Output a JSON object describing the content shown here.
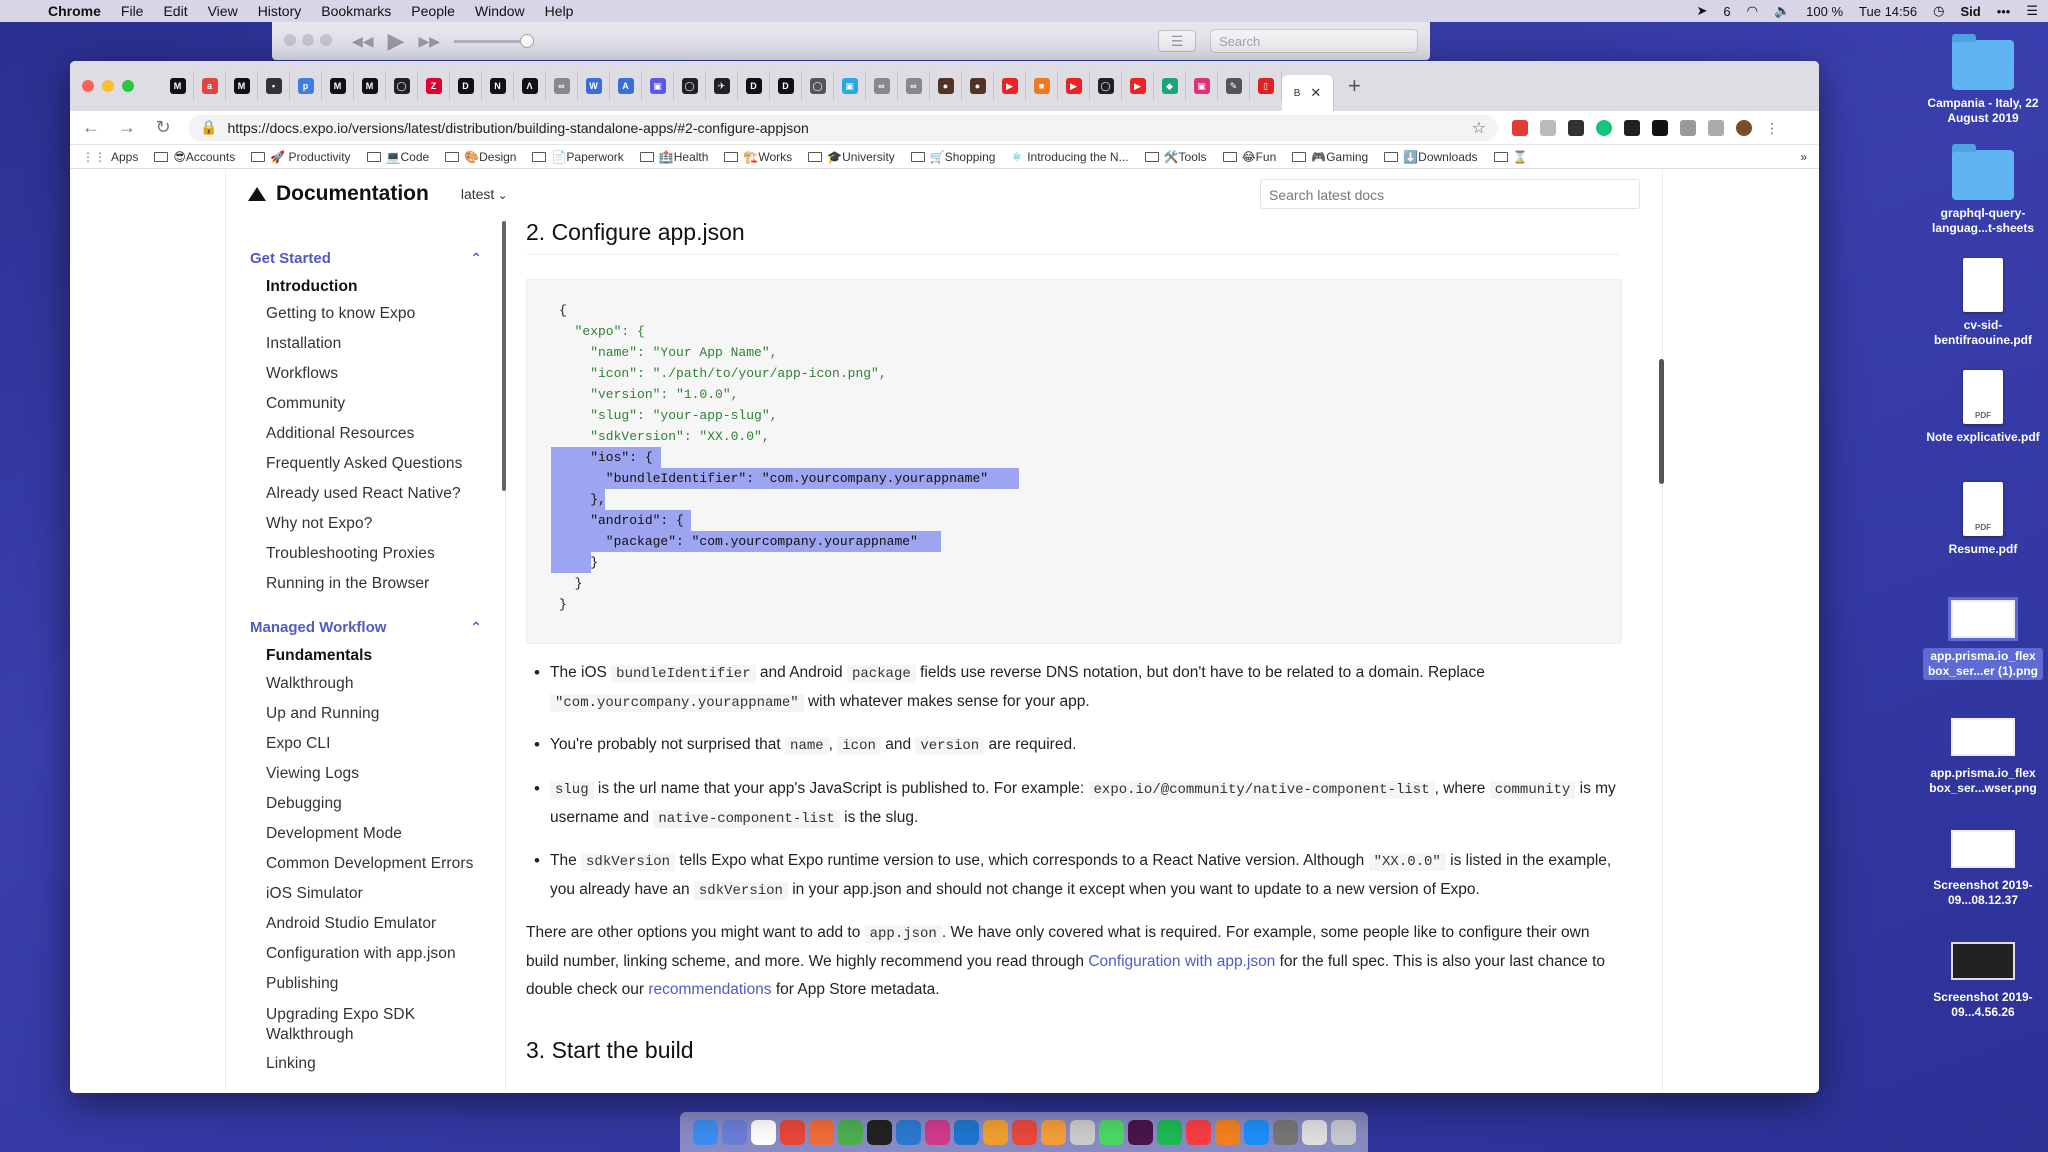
{
  "menubar": {
    "app": "Chrome",
    "items": [
      "File",
      "Edit",
      "View",
      "History",
      "Bookmarks",
      "People",
      "Window",
      "Help"
    ],
    "right": {
      "notif_count": "6",
      "battery": "100 %",
      "clock": "Tue 14:56",
      "user": "Sid"
    }
  },
  "player": {
    "search_placeholder": "Search"
  },
  "desktop": {
    "icons": [
      {
        "label": "Campania - Italy, 22 August 2019",
        "kind": "folder"
      },
      {
        "label": "graphql-query-languag...t-sheets",
        "kind": "folder"
      },
      {
        "label": "cv-sid-bentifraouine.pdf",
        "kind": "doc",
        "badge": ""
      },
      {
        "label": "Note explicative.pdf",
        "kind": "doc",
        "badge": "PDF"
      },
      {
        "label": "Resume.pdf",
        "kind": "doc",
        "badge": "PDF"
      },
      {
        "label": "app.prisma.io_flex box_ser...er (1).png",
        "kind": "shot",
        "selected": true
      },
      {
        "label": "app.prisma.io_flex box_ser...wser.png",
        "kind": "shot"
      },
      {
        "label": "Screenshot 2019-09...08.12.37",
        "kind": "shot"
      },
      {
        "label": "Screenshot 2019-09...4.56.26",
        "kind": "shot-dark"
      }
    ]
  },
  "browser": {
    "active_tab_label": "B",
    "url": "https://docs.expo.io/versions/latest/distribution/building-standalone-apps/#2-configure-appjson",
    "bookmarks": [
      "Apps",
      "😎Accounts",
      "🚀 Productivity",
      "💻Code",
      "🎨Design",
      "📄Paperwork",
      "🏥Health",
      "🏗️Works",
      "🎓University",
      "🛒Shopping",
      "Introducing the N...",
      "🛠️Tools",
      "😂Fun",
      "🎮Gaming",
      "⬇️Downloads",
      "⌛"
    ]
  },
  "docs": {
    "title": "Documentation",
    "version": "latest",
    "search_placeholder": "Search latest docs",
    "sidebar": {
      "section1": "Get Started",
      "section1_items": [
        "Introduction",
        "Getting to know Expo",
        "Installation",
        "Workflows",
        "Community",
        "Additional Resources",
        "Frequently Asked Questions",
        "Already used React Native?",
        "Why not Expo?",
        "Troubleshooting Proxies",
        "Running in the Browser"
      ],
      "section2": "Managed Workflow",
      "section2_sub": "Fundamentals",
      "section2_items": [
        "Walkthrough",
        "Up and Running",
        "Expo CLI",
        "Viewing Logs",
        "Debugging",
        "Development Mode",
        "Common Development Errors",
        "iOS Simulator",
        "Android Studio Emulator",
        "Configuration with app.json",
        "Publishing",
        "Upgrading Expo SDK Walkthrough",
        "Linking"
      ]
    },
    "step2_heading": "2. Configure app.json",
    "code_lines": [
      "{",
      "  \"expo\": {",
      "    \"name\": \"Your App Name\",",
      "    \"icon\": \"./path/to/your/app-icon.png\",",
      "    \"version\": \"1.0.0\",",
      "    \"slug\": \"your-app-slug\",",
      "    \"sdkVersion\": \"XX.0.0\",",
      "    \"ios\": {",
      "      \"bundleIdentifier\": \"com.yourcompany.yourappname\"",
      "    },",
      "    \"android\": {",
      "      \"package\": \"com.yourcompany.yourappname\"",
      "    }",
      "  }",
      "}"
    ],
    "bullets": {
      "b1_pre": "The iOS ",
      "b1_code1": "bundleIdentifier",
      "b1_mid1": " and Android ",
      "b1_code2": "package",
      "b1_mid2": " fields use reverse DNS notation, but don't have to be related to a domain. Replace ",
      "b1_code3": "\"com.yourcompany.yourappname\"",
      "b1_post": " with whatever makes sense for your app.",
      "b2_pre": "You're probably not surprised that ",
      "b2_code1": "name",
      "b2_sep1": ", ",
      "b2_code2": "icon",
      "b2_sep2": " and ",
      "b2_code3": "version",
      "b2_post": " are required.",
      "b3_code1": "slug",
      "b3_mid1": " is the url name that your app's JavaScript is published to. For example: ",
      "b3_code2": "expo.io/@community/native-component-list",
      "b3_mid2": ", where ",
      "b3_code3": "community",
      "b3_mid3": " is my username and ",
      "b3_code4": "native-component-list",
      "b3_post": " is the slug.",
      "b4_pre": "The ",
      "b4_code1": "sdkVersion",
      "b4_mid1": " tells Expo what Expo runtime version to use, which corresponds to a React Native version. Although ",
      "b4_code2": "\"XX.0.0\"",
      "b4_mid2": " is listed in the example, you already have an ",
      "b4_code3": "sdkVersion",
      "b4_post": " in your app.json and should not change it except when you want to update to a new version of Expo."
    },
    "para": {
      "pre": "There are other options you might want to add to ",
      "code": "app.json",
      "mid": ". We have only covered what is required. For example, some people like to configure their own build number, linking scheme, and more. We highly recommend you read through ",
      "link1": "Configuration with app.json",
      "mid2": " for the full spec. This is also your last chance to double check our ",
      "link2": "recommendations",
      "post": " for App Store metadata."
    },
    "step3_heading": "3. Start the build"
  },
  "colors": {
    "accent": "#4f5bc7",
    "selection": "#9da4f0",
    "desktop": "#3a3fae"
  }
}
